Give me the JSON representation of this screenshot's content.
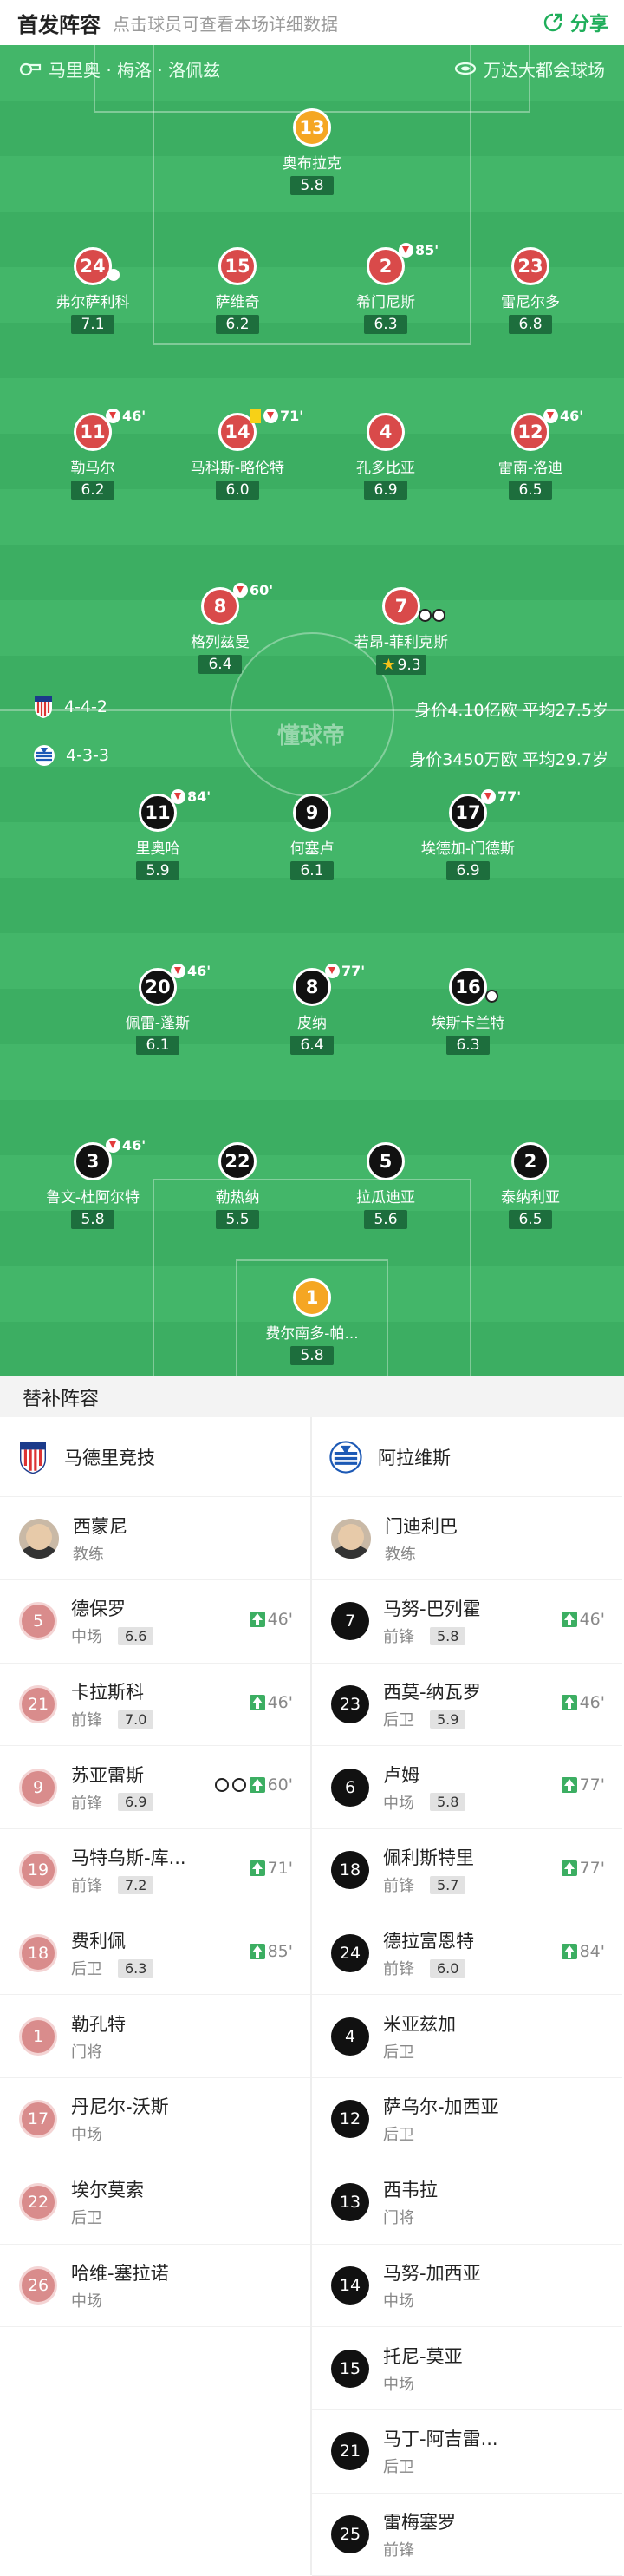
{
  "header": {
    "title": "首发阵容",
    "subtitle": "点击球员可查看本场详细数据",
    "share_label": "分享"
  },
  "venue": {
    "referee": "马里奥 · 梅洛 · 洛佩兹",
    "stadium": "万达大都会球场"
  },
  "watermark": "懂球帝",
  "home_team": {
    "formation": "4-4-2",
    "value_text": "身价4.10亿欧 平均27.5岁",
    "players": [
      {
        "num": "13",
        "name": "奥布拉克",
        "rating": "5.8"
      },
      {
        "num": "24",
        "name": "弗尔萨利科",
        "rating": "7.1"
      },
      {
        "num": "15",
        "name": "萨维奇",
        "rating": "6.2"
      },
      {
        "num": "2",
        "name": "希门尼斯",
        "rating": "6.3",
        "sub": "85'"
      },
      {
        "num": "23",
        "name": "雷尼尔多",
        "rating": "6.8"
      },
      {
        "num": "11",
        "name": "勒马尔",
        "rating": "6.2",
        "sub": "46'"
      },
      {
        "num": "14",
        "name": "马科斯-略伦特",
        "rating": "6.0",
        "sub": "71'"
      },
      {
        "num": "4",
        "name": "孔多比亚",
        "rating": "6.9"
      },
      {
        "num": "12",
        "name": "雷南-洛迪",
        "rating": "6.5",
        "sub": "46'"
      },
      {
        "num": "8",
        "name": "格列兹曼",
        "rating": "6.4",
        "sub": "60'"
      },
      {
        "num": "7",
        "name": "若昂-菲利克斯",
        "rating": "9.3"
      }
    ]
  },
  "away_team": {
    "formation": "4-3-3",
    "value_text": "身价3450万欧 平均29.7岁",
    "players": [
      {
        "num": "11",
        "name": "里奥哈",
        "rating": "5.9",
        "sub": "84'"
      },
      {
        "num": "9",
        "name": "何塞卢",
        "rating": "6.1"
      },
      {
        "num": "17",
        "name": "埃德加-门德斯",
        "rating": "6.9",
        "sub": "77'"
      },
      {
        "num": "20",
        "name": "佩雷-蓬斯",
        "rating": "6.1",
        "sub": "46'"
      },
      {
        "num": "8",
        "name": "皮纳",
        "rating": "6.4",
        "sub": "77'"
      },
      {
        "num": "16",
        "name": "埃斯卡兰特",
        "rating": "6.3"
      },
      {
        "num": "3",
        "name": "鲁文-杜阿尔特",
        "rating": "5.8",
        "sub": "46'"
      },
      {
        "num": "22",
        "name": "勒热纳",
        "rating": "5.5"
      },
      {
        "num": "5",
        "name": "拉瓜迪亚",
        "rating": "5.6"
      },
      {
        "num": "2",
        "name": "泰纳利亚",
        "rating": "6.5"
      },
      {
        "num": "1",
        "name": "费尔南多-帕...",
        "rating": "5.8"
      }
    ]
  },
  "subs_section": {
    "title": "替补阵容",
    "home": {
      "team_name": "马德里竞技",
      "coach": {
        "name": "西蒙尼",
        "role": "教练"
      },
      "players": [
        {
          "num": "5",
          "name": "德保罗",
          "pos": "中场",
          "rating": "6.6",
          "in": "46'"
        },
        {
          "num": "21",
          "name": "卡拉斯科",
          "pos": "前锋",
          "rating": "7.0",
          "in": "46'"
        },
        {
          "num": "9",
          "name": "苏亚雷斯",
          "pos": "前锋",
          "rating": "6.9",
          "in": "60'"
        },
        {
          "num": "19",
          "name": "马特乌斯-库...",
          "pos": "前锋",
          "rating": "7.2",
          "in": "71'"
        },
        {
          "num": "18",
          "name": "费利佩",
          "pos": "后卫",
          "rating": "6.3",
          "in": "85'"
        },
        {
          "num": "1",
          "name": "勒孔特",
          "pos": "门将"
        },
        {
          "num": "17",
          "name": "丹尼尔-沃斯",
          "pos": "中场"
        },
        {
          "num": "22",
          "name": "埃尔莫索",
          "pos": "后卫"
        },
        {
          "num": "26",
          "name": "哈维-塞拉诺",
          "pos": "中场"
        }
      ]
    },
    "away": {
      "team_name": "阿拉维斯",
      "coach": {
        "name": "门迪利巴",
        "role": "教练"
      },
      "players": [
        {
          "num": "7",
          "name": "马努-巴列霍",
          "pos": "前锋",
          "rating": "5.8",
          "in": "46'"
        },
        {
          "num": "23",
          "name": "西莫-纳瓦罗",
          "pos": "后卫",
          "rating": "5.9",
          "in": "46'"
        },
        {
          "num": "6",
          "name": "卢姆",
          "pos": "中场",
          "rating": "5.8",
          "in": "77'"
        },
        {
          "num": "18",
          "name": "佩利斯特里",
          "pos": "前锋",
          "rating": "5.7",
          "in": "77'"
        },
        {
          "num": "24",
          "name": "德拉富恩特",
          "pos": "前锋",
          "rating": "6.0",
          "in": "84'"
        },
        {
          "num": "4",
          "name": "米亚兹加",
          "pos": "后卫"
        },
        {
          "num": "12",
          "name": "萨乌尔-加西亚",
          "pos": "后卫"
        },
        {
          "num": "13",
          "name": "西韦拉",
          "pos": "门将"
        },
        {
          "num": "14",
          "name": "马努-加西亚",
          "pos": "中场"
        },
        {
          "num": "15",
          "name": "托尼-莫亚",
          "pos": "中场"
        },
        {
          "num": "21",
          "name": "马丁-阿吉雷...",
          "pos": "后卫"
        },
        {
          "num": "25",
          "name": "雷梅塞罗",
          "pos": "前锋"
        }
      ]
    }
  },
  "colors": {
    "pitch": "#43b669",
    "home": "#d94a4a",
    "away": "#111111",
    "keeper": "#f5a623",
    "accent": "#1fae5a"
  }
}
